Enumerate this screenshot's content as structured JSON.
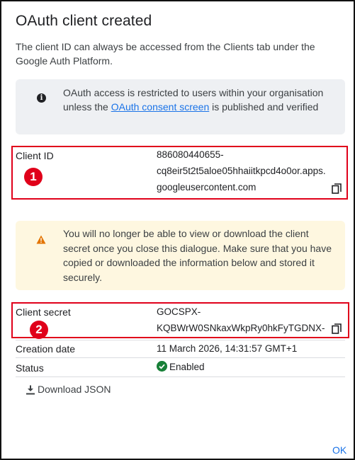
{
  "dialog": {
    "title": "OAuth client created",
    "intro": "The client ID can always be accessed from the Clients tab under the Google Auth Platform.",
    "info": {
      "text_before": "OAuth access is restricted to users within your organisation unless the ",
      "link": "OAuth consent screen",
      "text_after": " is published and verified",
      "icon": "info-icon"
    },
    "client_id": {
      "label": "Client ID",
      "line1": "886080440655-",
      "line2": "cq8eir5t2t5aloe05hhaiitkpcd4o0or.apps.",
      "line3": "googleusercontent.com",
      "icon": "copy-icon"
    },
    "warning": {
      "text": "You will no longer be able to view or download the client secret once you close this dialogue. Make sure that you have copied or downloaded the information below and stored it securely.",
      "icon": "warning-icon"
    },
    "client_secret": {
      "label": "Client secret",
      "line1": "GOCSPX-",
      "line2": "KQBWrW0SNkaxWkpRy0hkFyTGDNX-",
      "icon": "copy-icon"
    },
    "creation_date": {
      "label": "Creation date",
      "value": "11 March 2026, 14:31:57 GMT+1"
    },
    "status": {
      "label": "Status",
      "value": "Enabled",
      "icon": "check-circle-icon"
    },
    "download": {
      "label": "Download JSON",
      "icon": "download-icon"
    },
    "ok_label": "OK"
  },
  "annotations": {
    "badge1": "1",
    "badge2": "2",
    "color": "#e0001a"
  },
  "colors": {
    "link": "#1a73e8",
    "info_bg": "#eef0f3",
    "warn_bg": "#fef7e0",
    "warn_icon": "#e37400",
    "enabled_green": "#188038"
  }
}
